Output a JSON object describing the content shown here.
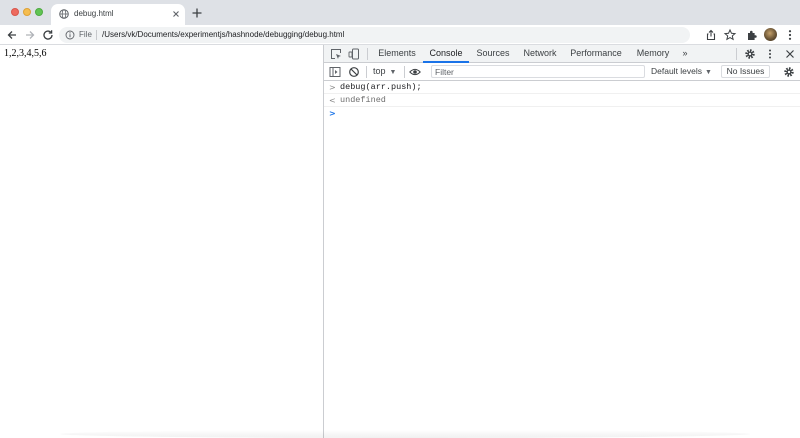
{
  "browser": {
    "tab": {
      "title": "debug.html"
    },
    "omnibox": {
      "scheme": "File",
      "url": "/Users/vk/Documents/experimentjs/hashnode/debugging/debug.html"
    }
  },
  "page": {
    "output": "1,2,3,4,5,6"
  },
  "devtools": {
    "tabs": [
      "Elements",
      "Console",
      "Sources",
      "Network",
      "Performance",
      "Memory"
    ],
    "active_tab": "Console",
    "more_tabs": "»",
    "console_toolbar": {
      "context": "top",
      "filter_placeholder": "Filter",
      "levels": "Default levels",
      "issues": "No Issues"
    },
    "console": {
      "entries": [
        {
          "type": "input",
          "prefix": ">",
          "text": "debug(arr.push);"
        },
        {
          "type": "result",
          "prefix": "<",
          "text": "undefined"
        }
      ],
      "prompt_prefix": ">"
    }
  },
  "colors": {
    "accent": "#1a73e8",
    "tabstrip": "#dee1e6",
    "omnibox": "#f1f3f4"
  }
}
